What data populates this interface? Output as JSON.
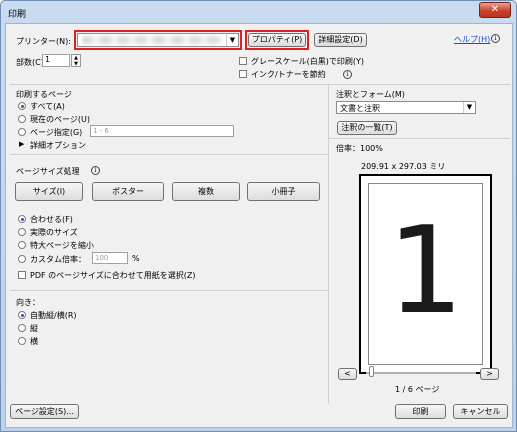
{
  "window": {
    "title": "印刷",
    "close_label": "✕"
  },
  "printer": {
    "label": "プリンター(N):",
    "selected": "",
    "properties_label": "プロパティ(P)",
    "advanced_label": "詳細設定(D)",
    "help_label": "ヘルプ(H)"
  },
  "copies": {
    "label": "部数(C):",
    "value": "1"
  },
  "options": {
    "grayscale_label": "グレースケール(白黒)で印刷(Y)",
    "grayscale_checked": false,
    "ink_save_label": "インク/トナーを節約",
    "ink_save_checked": false
  },
  "pages": {
    "section_label": "印刷するページ",
    "all_label": "すべて(A)",
    "current_label": "現在のページ(U)",
    "range_label": "ページ指定(G)",
    "range_placeholder": "1 - 6",
    "more_options_label": "詳細オプション",
    "selected": "all"
  },
  "sizing": {
    "section_label": "ページサイズ処理",
    "modes": [
      "サイズ(I)",
      "ポスター",
      "複数",
      "小冊子"
    ],
    "fit_label": "合わせる(F)",
    "actual_label": "実際のサイズ",
    "shrink_label": "特大ページを縮小",
    "custom_label": "カスタム倍率：",
    "custom_value": "100",
    "custom_unit": "%",
    "paper_by_pdf_label": "PDF のページサイズに合わせて用紙を選択(Z)",
    "paper_by_pdf_checked": false,
    "selected": "fit"
  },
  "orientation": {
    "section_label": "向き：",
    "auto_label": "自動縦/横(R)",
    "portrait_label": "縦",
    "landscape_label": "横",
    "selected": "auto"
  },
  "comments": {
    "section_label": "注釈とフォーム(M)",
    "selected": "文書と注釈",
    "summary_label": "注釈の一覧(T)"
  },
  "preview": {
    "zoom_label": "倍率：100%",
    "size_label": "209.91 x 297.03 ミリ",
    "page_number": "1",
    "prev_label": "<",
    "next_label": ">",
    "page_indicator": "1 / 6 ページ"
  },
  "footer": {
    "page_setup_label": "ページ設定(S)...",
    "print_label": "印刷",
    "cancel_label": "キャンセル"
  },
  "colors": {
    "highlight": "#e02020",
    "title_bar": "#c9dbef",
    "link": "#1a4fcc"
  }
}
